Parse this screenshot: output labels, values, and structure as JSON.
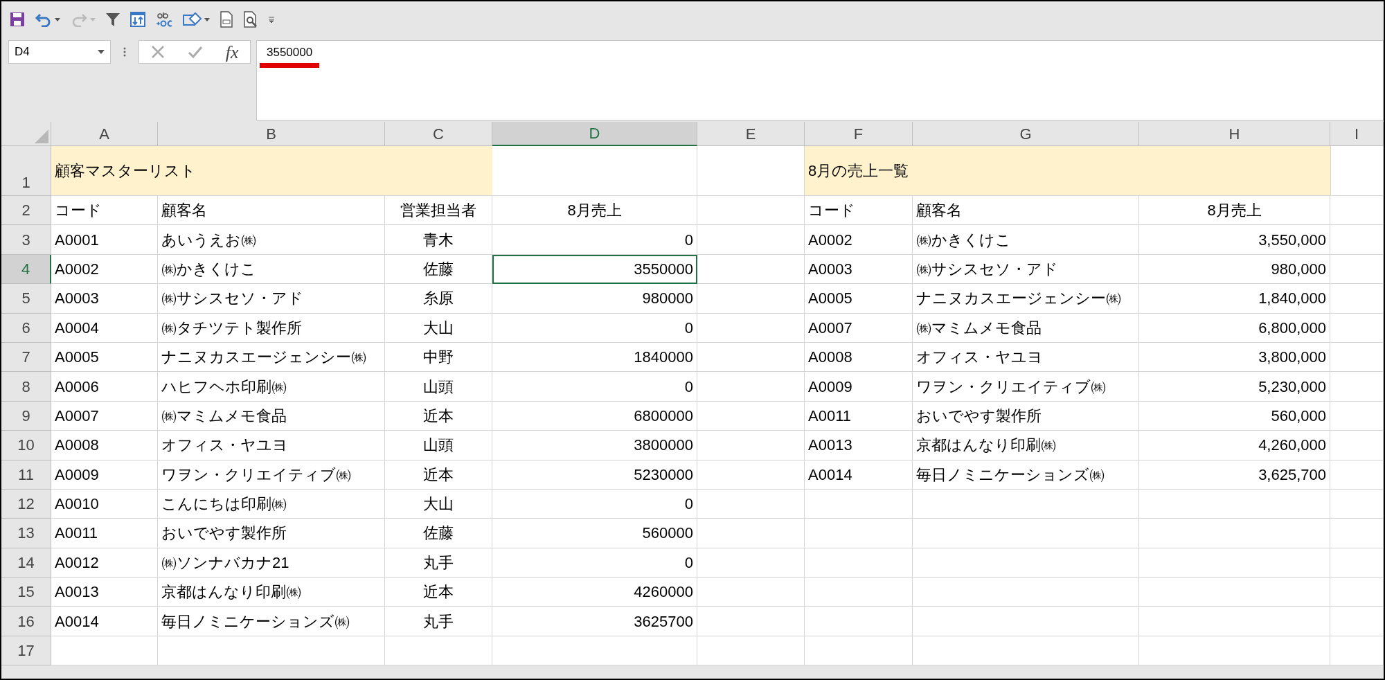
{
  "toolbar": {
    "redo_disabled": true
  },
  "formula_bar": {
    "function_button": "fx",
    "name_box": "D4",
    "formula": "3550000",
    "formula_underlined": true
  },
  "column_headers": [
    {
      "label": "A",
      "selected": false
    },
    {
      "label": "B",
      "selected": false
    },
    {
      "label": "C",
      "selected": false
    },
    {
      "label": "D",
      "selected": true
    },
    {
      "label": "E",
      "selected": false
    },
    {
      "label": "F",
      "selected": false
    },
    {
      "label": "G",
      "selected": false
    },
    {
      "label": "H",
      "selected": false
    },
    {
      "label": "I",
      "selected": false
    }
  ],
  "row_headers": [
    {
      "label": "1",
      "selected": false
    },
    {
      "label": "2",
      "selected": false
    },
    {
      "label": "3",
      "selected": false
    },
    {
      "label": "4",
      "selected": true
    },
    {
      "label": "5",
      "selected": false
    },
    {
      "label": "6",
      "selected": false
    },
    {
      "label": "7",
      "selected": false
    },
    {
      "label": "8",
      "selected": false
    },
    {
      "label": "9",
      "selected": false
    },
    {
      "label": "10",
      "selected": false
    },
    {
      "label": "11",
      "selected": false
    },
    {
      "label": "12",
      "selected": false
    },
    {
      "label": "13",
      "selected": false
    },
    {
      "label": "14",
      "selected": false
    },
    {
      "label": "15",
      "selected": false
    },
    {
      "label": "16",
      "selected": false
    },
    {
      "label": "17",
      "selected": false
    }
  ],
  "master_list": {
    "title": "顧客マスターリスト",
    "headers": [
      "コード",
      "顧客名",
      "営業担当者",
      "8月売上"
    ],
    "rows": [
      [
        "A0001",
        "あいうえお㈱",
        "青木",
        "0"
      ],
      [
        "A0002",
        "㈱かきくけこ",
        "佐藤",
        "3550000"
      ],
      [
        "A0003",
        "㈱サシスセソ・アド",
        "糸原",
        "980000"
      ],
      [
        "A0004",
        "㈱タチツテト製作所",
        "大山",
        "0"
      ],
      [
        "A0005",
        "ナニヌカスエージェンシー㈱",
        "中野",
        "1840000"
      ],
      [
        "A0006",
        "ハヒフヘホ印刷㈱",
        "山頭",
        "0"
      ],
      [
        "A0007",
        "㈱マミムメモ食品",
        "近本",
        "6800000"
      ],
      [
        "A0008",
        "オフィス・ヤユヨ",
        "山頭",
        "3800000"
      ],
      [
        "A0009",
        "ワヲン・クリエイティブ㈱",
        "近本",
        "5230000"
      ],
      [
        "A0010",
        "こんにちは印刷㈱",
        "大山",
        "0"
      ],
      [
        "A0011",
        "おいでやす製作所",
        "佐藤",
        "560000"
      ],
      [
        "A0012",
        "㈱ソンナバカナ21",
        "丸手",
        "0"
      ],
      [
        "A0013",
        "京都はんなり印刷㈱",
        "近本",
        "4260000"
      ],
      [
        "A0014",
        "毎日ノミニケーションズ㈱",
        "丸手",
        "3625700"
      ]
    ]
  },
  "sales_list": {
    "title": "8月の売上一覧",
    "headers": [
      "コード",
      "顧客名",
      "8月売上"
    ],
    "rows": [
      [
        "A0002",
        "㈱かきくけこ",
        "3,550,000"
      ],
      [
        "A0003",
        "㈱サシスセソ・アド",
        "980,000"
      ],
      [
        "A0005",
        "ナニヌカスエージェンシー㈱",
        "1,840,000"
      ],
      [
        "A0007",
        "㈱マミムメモ食品",
        "6,800,000"
      ],
      [
        "A0008",
        "オフィス・ヤユヨ",
        "3,800,000"
      ],
      [
        "A0009",
        "ワヲン・クリエイティブ㈱",
        "5,230,000"
      ],
      [
        "A0011",
        "おいでやす製作所",
        "560,000"
      ],
      [
        "A0013",
        "京都はんなり印刷㈱",
        "4,260,000"
      ],
      [
        "A0014",
        "毎日ノミニケーションズ㈱",
        "3,625,700"
      ]
    ]
  }
}
